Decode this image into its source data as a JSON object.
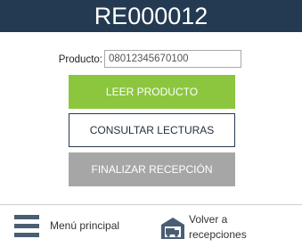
{
  "header": {
    "title": "RE000012"
  },
  "product": {
    "label": "Producto:",
    "value": "08012345670100"
  },
  "buttons": {
    "read": "LEER PRODUCTO",
    "consult": "CONSULTAR LECTURAS",
    "finish": "FINALIZAR RECEPCIÓN"
  },
  "nav": {
    "main_menu": {
      "label": "Menú principal",
      "icon": "menu-icon"
    },
    "back": {
      "label": "Volver a recepciones",
      "icon": "warehouse-truck-icon"
    }
  },
  "colors": {
    "header_bg": "#243a52",
    "read_button": "#8cc63f",
    "finish_button": "#a6a6a6"
  }
}
